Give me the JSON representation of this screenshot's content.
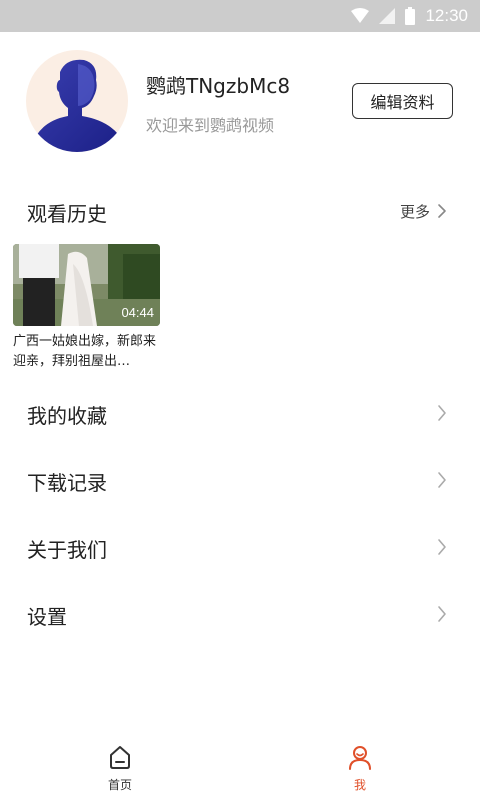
{
  "status_bar": {
    "time": "12:30"
  },
  "profile": {
    "nickname": "鹦鹉TNgzbMc8",
    "welcome": "欢迎来到鹦鹉视频",
    "edit_label": "编辑资料"
  },
  "history": {
    "title": "观看历史",
    "more_label": "更多",
    "items": [
      {
        "duration": "04:44",
        "title": "广西一姑娘出嫁，新郎来迎亲，拜别祖屋出…"
      }
    ]
  },
  "menu": {
    "items": [
      {
        "label": "我的收藏"
      },
      {
        "label": "下载记录"
      },
      {
        "label": "关于我们"
      },
      {
        "label": "设置"
      }
    ]
  },
  "tabbar": {
    "tabs": [
      {
        "label": "首页",
        "icon": "home-icon",
        "active": false
      },
      {
        "label": "我",
        "icon": "user-icon",
        "active": true
      }
    ],
    "active_color": "#e0502a",
    "inactive_color": "#333333"
  }
}
